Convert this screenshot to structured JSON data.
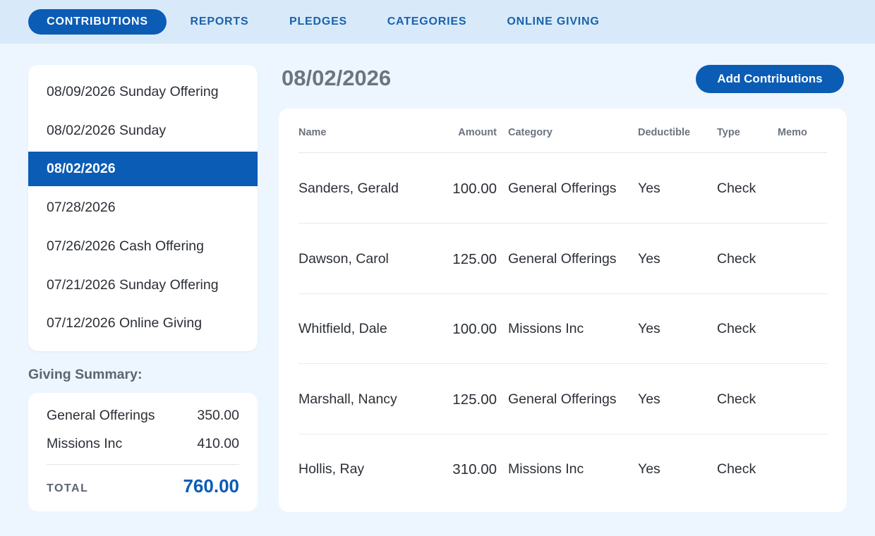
{
  "nav": {
    "tabs": [
      {
        "label": "CONTRIBUTIONS",
        "active": true
      },
      {
        "label": "REPORTS",
        "active": false
      },
      {
        "label": "PLEDGES",
        "active": false
      },
      {
        "label": "CATEGORIES",
        "active": false
      },
      {
        "label": "ONLINE GIVING",
        "active": false
      }
    ]
  },
  "batches": [
    {
      "label": "08/09/2026 Sunday Offering",
      "selected": false
    },
    {
      "label": "08/02/2026 Sunday",
      "selected": false
    },
    {
      "label": "08/02/2026",
      "selected": true
    },
    {
      "label": "07/28/2026",
      "selected": false
    },
    {
      "label": "07/26/2026 Cash Offering",
      "selected": false
    },
    {
      "label": "07/21/2026 Sunday Offering",
      "selected": false
    },
    {
      "label": "07/12/2026 Online Giving",
      "selected": false
    }
  ],
  "summary": {
    "heading": "Giving Summary:",
    "rows": [
      {
        "category": "General Offerings",
        "amount": "350.00"
      },
      {
        "category": "Missions Inc",
        "amount": "410.00"
      }
    ],
    "total_label": "TOTAL",
    "total_value": "760.00"
  },
  "main": {
    "title": "08/02/2026",
    "add_button_label": "Add Contributions"
  },
  "table": {
    "headers": {
      "name": "Name",
      "amount": "Amount",
      "category": "Category",
      "deductible": "Deductible",
      "type": "Type",
      "memo": "Memo"
    },
    "rows": [
      {
        "name": "Sanders, Gerald",
        "amount": "100.00",
        "category": "General Offerings",
        "deductible": "Yes",
        "type": "Check",
        "memo": ""
      },
      {
        "name": "Dawson, Carol",
        "amount": "125.00",
        "category": "General Offerings",
        "deductible": "Yes",
        "type": "Check",
        "memo": ""
      },
      {
        "name": "Whitfield, Dale",
        "amount": "100.00",
        "category": "Missions Inc",
        "deductible": "Yes",
        "type": "Check",
        "memo": ""
      },
      {
        "name": "Marshall, Nancy",
        "amount": "125.00",
        "category": "General Offerings",
        "deductible": "Yes",
        "type": "Check",
        "memo": ""
      },
      {
        "name": "Hollis, Ray",
        "amount": "310.00",
        "category": "Missions Inc",
        "deductible": "Yes",
        "type": "Check",
        "memo": ""
      }
    ]
  },
  "colors": {
    "accent": "#0b5cb5",
    "nav_background": "#d8eafa",
    "page_background": "#edf6fe"
  }
}
